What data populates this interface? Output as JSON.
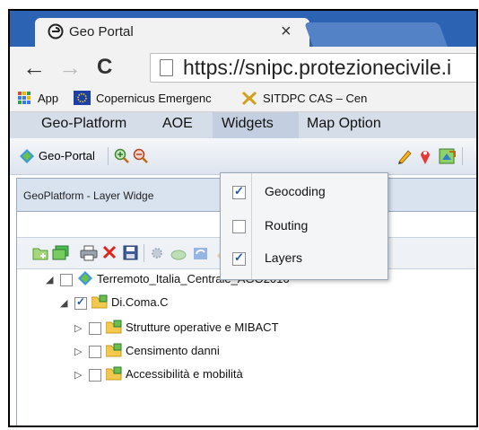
{
  "browser": {
    "tab_title": "Geo Portal",
    "tab_close": "×",
    "url": "https://snipc.protezionecivile.i",
    "back": "←",
    "forward": "→",
    "reload": "C",
    "bookmarks": [
      {
        "label": "App"
      },
      {
        "label": "Copernicus Emergenc"
      },
      {
        "label": "SITDPC CAS – Cen"
      }
    ]
  },
  "menubar": {
    "items": [
      "Geo-Platform",
      "AOE",
      "Widgets",
      "Map Option"
    ],
    "active": "Widgets"
  },
  "toolbar": {
    "geo_portal_label": "Geo-Portal"
  },
  "panel": {
    "title": "GeoPlatform - Layer Widge"
  },
  "tree": [
    {
      "label": "Terremoto_Italia_Centrale_AGO2016",
      "checked": false,
      "expanded": true
    },
    {
      "label": "Di.Coma.C",
      "checked": true,
      "expanded": true
    },
    {
      "label": "Strutture operative e MIBACT",
      "checked": false,
      "expanded": false
    },
    {
      "label": "Censimento danni",
      "checked": false,
      "expanded": false
    },
    {
      "label": "Accessibilità e mobilità",
      "checked": false,
      "expanded": false
    }
  ],
  "dropdown": {
    "items": [
      {
        "label": "Geocoding",
        "checked": true
      },
      {
        "label": "Routing",
        "checked": false
      },
      {
        "label": "Layers",
        "checked": true
      }
    ]
  },
  "colors": {
    "titlebar": "#2c63b3",
    "menubar": "#d5dde9",
    "checkmark": "#1f57b7"
  }
}
